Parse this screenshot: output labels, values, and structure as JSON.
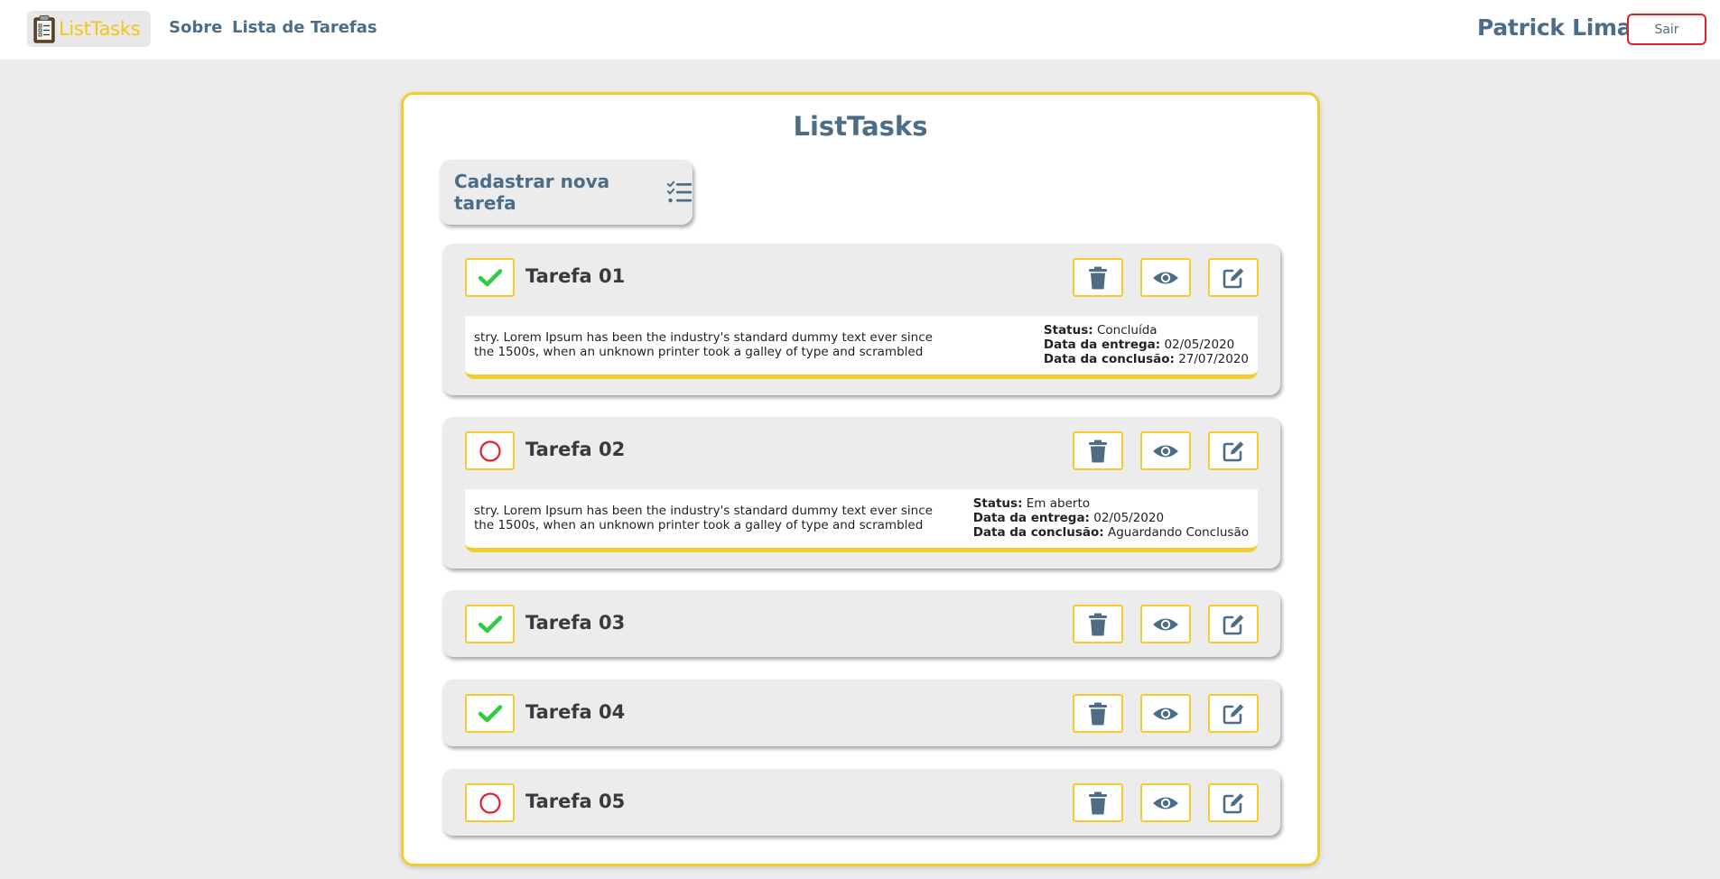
{
  "header": {
    "brand": "ListTasks",
    "nav": [
      "Sobre",
      "Lista de Tarefas"
    ],
    "user": "Patrick Lima",
    "logout": "Sair"
  },
  "main": {
    "title": "ListTasks",
    "new_task_label": "Cadastrar nova tarefa"
  },
  "labels": {
    "status": "Status:",
    "due": "Data da entrega:",
    "done": "Data da conclusão:"
  },
  "tasks": [
    {
      "title": "Tarefa 01",
      "completed": true,
      "expanded": true,
      "description": "stry. Lorem Ipsum has been the industry's standard dummy text ever since the 1500s, when an unknown printer took a galley of type and scrambled",
      "status": "Concluída",
      "due_date": "02/05/2020",
      "completion_date": "27/07/2020"
    },
    {
      "title": "Tarefa 02",
      "completed": false,
      "expanded": true,
      "description": "stry. Lorem Ipsum has been the industry's standard dummy text ever since the 1500s, when an unknown printer took a galley of type and scrambled",
      "status": "Em aberto",
      "due_date": "02/05/2020",
      "completion_date": "Aguardando Conclusão"
    },
    {
      "title": "Tarefa 03",
      "completed": true,
      "expanded": false
    },
    {
      "title": "Tarefa 04",
      "completed": true,
      "expanded": false
    },
    {
      "title": "Tarefa 05",
      "completed": false,
      "expanded": false
    }
  ],
  "colors": {
    "accent": "#f5cc2e",
    "primary_text": "#4d6d86",
    "check": "#2ecc40",
    "open_circle": "#e0202a",
    "background": "#ececec"
  },
  "icons": {
    "delete": "trash-icon",
    "view": "eye-icon",
    "edit": "edit-icon",
    "complete": "check-icon",
    "open": "circle-icon"
  }
}
